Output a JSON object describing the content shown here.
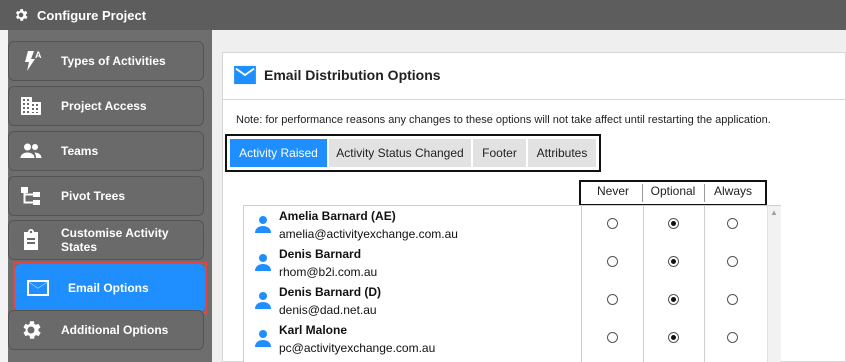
{
  "window": {
    "title": "Configure Project"
  },
  "sidebar": {
    "items": [
      {
        "label": "Types of Activities",
        "icon": "lightning-a-icon",
        "active": false
      },
      {
        "label": "Project Access",
        "icon": "building-icon",
        "active": false
      },
      {
        "label": "Teams",
        "icon": "people-icon",
        "active": false
      },
      {
        "label": "Pivot Trees",
        "icon": "tree-icon",
        "active": false
      },
      {
        "label": "Customise Activity States",
        "icon": "clipboard-icon",
        "active": false
      },
      {
        "label": "Email Options",
        "icon": "envelope-icon",
        "active": true
      },
      {
        "label": "Additional Options",
        "icon": "gear-icon",
        "active": false
      }
    ]
  },
  "panel": {
    "title": "Email Distribution Options",
    "note": "Note: for performance reasons any changes to these options will not take affect until restarting the application."
  },
  "tabs": [
    {
      "label": "Activity Raised",
      "active": true
    },
    {
      "label": "Activity Status Changed",
      "active": false
    },
    {
      "label": "Footer",
      "active": false
    },
    {
      "label": "Attributes",
      "active": false
    }
  ],
  "columns": {
    "never": "Never",
    "optional": "Optional",
    "always": "Always"
  },
  "users": [
    {
      "name": "Amelia Barnard (AE)",
      "email": "amelia@activityexchange.com.au",
      "selected": "Optional"
    },
    {
      "name": "Denis Barnard",
      "email": "rhom@b2i.com.au",
      "selected": "Optional"
    },
    {
      "name": "Denis Barnard (D)",
      "email": "denis@dad.net.au",
      "selected": "Optional"
    },
    {
      "name": "Karl Malone",
      "email": "pc@activityexchange.com.au",
      "selected": "Optional"
    }
  ],
  "colors": {
    "accent": "#1f8fff",
    "sidebar": "#6e6e6e",
    "highlight": "#e04646"
  }
}
